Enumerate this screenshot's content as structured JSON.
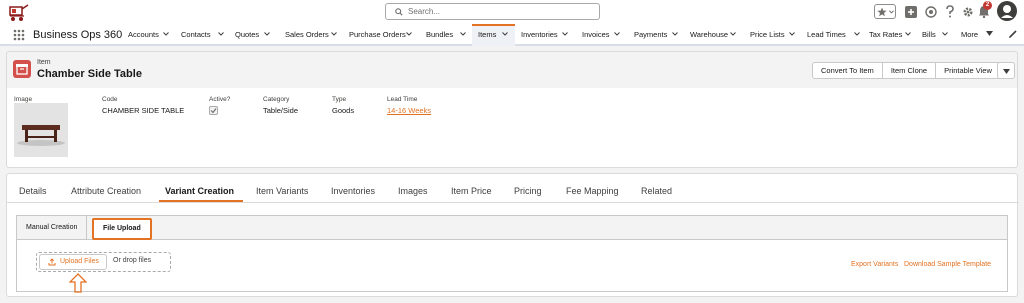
{
  "header": {
    "search_placeholder": "Search...",
    "notification_count": "2"
  },
  "nav": {
    "app_name": "Business Ops 360",
    "items": [
      {
        "label": "Accounts"
      },
      {
        "label": "Contacts"
      },
      {
        "label": "Quotes"
      },
      {
        "label": "Sales Orders"
      },
      {
        "label": "Purchase Orders"
      },
      {
        "label": "Bundles"
      },
      {
        "label": "Items"
      },
      {
        "label": "Inventories"
      },
      {
        "label": "Invoices"
      },
      {
        "label": "Payments"
      },
      {
        "label": "Warehouse"
      },
      {
        "label": "Price Lists"
      },
      {
        "label": "Lead Times"
      },
      {
        "label": "Tax Rates"
      },
      {
        "label": "Bills"
      },
      {
        "label": "More"
      }
    ],
    "active_item": "Items"
  },
  "record": {
    "object_type": "Item",
    "title": "Chamber Side Table",
    "actions": {
      "convert": "Convert To Item",
      "clone": "Item Clone",
      "printable": "Printable View"
    }
  },
  "highlights": {
    "image_label": "Image",
    "code_label": "Code",
    "code_value": "CHAMBER SIDE TABLE",
    "active_label": "Active?",
    "active_value": true,
    "category_label": "Category",
    "category_value": "Table/Side",
    "type_label": "Type",
    "type_value": "Goods",
    "lead_time_label": "Lead Time",
    "lead_time_value": "14-16 Weeks"
  },
  "tabs": {
    "items": [
      {
        "label": "Details"
      },
      {
        "label": "Attribute Creation"
      },
      {
        "label": "Variant Creation"
      },
      {
        "label": "Item Variants"
      },
      {
        "label": "Inventories"
      },
      {
        "label": "Images"
      },
      {
        "label": "Item Price"
      },
      {
        "label": "Pricing"
      },
      {
        "label": "Fee Mapping"
      },
      {
        "label": "Related"
      }
    ],
    "active": "Variant Creation"
  },
  "variant_panel": {
    "subtabs": [
      {
        "label": "Manual Creation"
      },
      {
        "label": "File Upload"
      }
    ],
    "active_subtab": "File Upload",
    "upload_button": "Upload Files",
    "drop_text": "Or drop files",
    "export_link": "Export Variants",
    "download_link": "Download Sample Template"
  },
  "colors": {
    "accent": "#e37222",
    "record_icon": "#d4504c",
    "nav_active_bg": "#eef1f6"
  },
  "icons": [
    "logo-icon",
    "search-icon",
    "favorites-star-icon",
    "add-icon",
    "help-icon",
    "setup-gear-icon",
    "notification-bell-icon",
    "app-launcher-icon",
    "chevron-down-icon",
    "pencil-icon",
    "item-icon",
    "upload-icon",
    "arrow-up-annotation-icon"
  ]
}
